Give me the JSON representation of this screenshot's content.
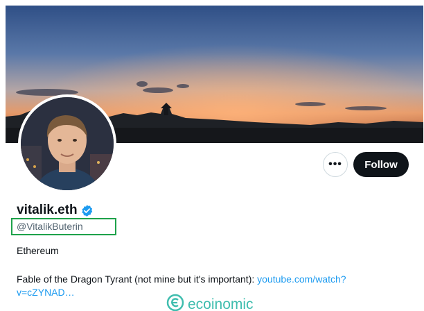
{
  "profile": {
    "display_name": "vitalik.eth",
    "handle": "@VitalikButerin",
    "verified": true
  },
  "actions": {
    "more_label": "•••",
    "follow_label": "Follow"
  },
  "bio": {
    "line1": "Ethereum",
    "text": "Fable of the Dragon Tyrant (not mine but it's important): ",
    "link_part1": "youtube.com/watch?",
    "link_part2": "v=cZYNAD…"
  },
  "watermark": {
    "text": "ecoinomic"
  },
  "icons": {
    "verified": "verified-badge-icon",
    "more": "more-icon",
    "watermark_logo": "ecoinomic-logo-icon"
  },
  "colors": {
    "accent_blue": "#1d9bf0",
    "follow_bg": "#0f1419",
    "handle_highlight": "#1ea24a",
    "watermark": "#2bb6a6"
  }
}
